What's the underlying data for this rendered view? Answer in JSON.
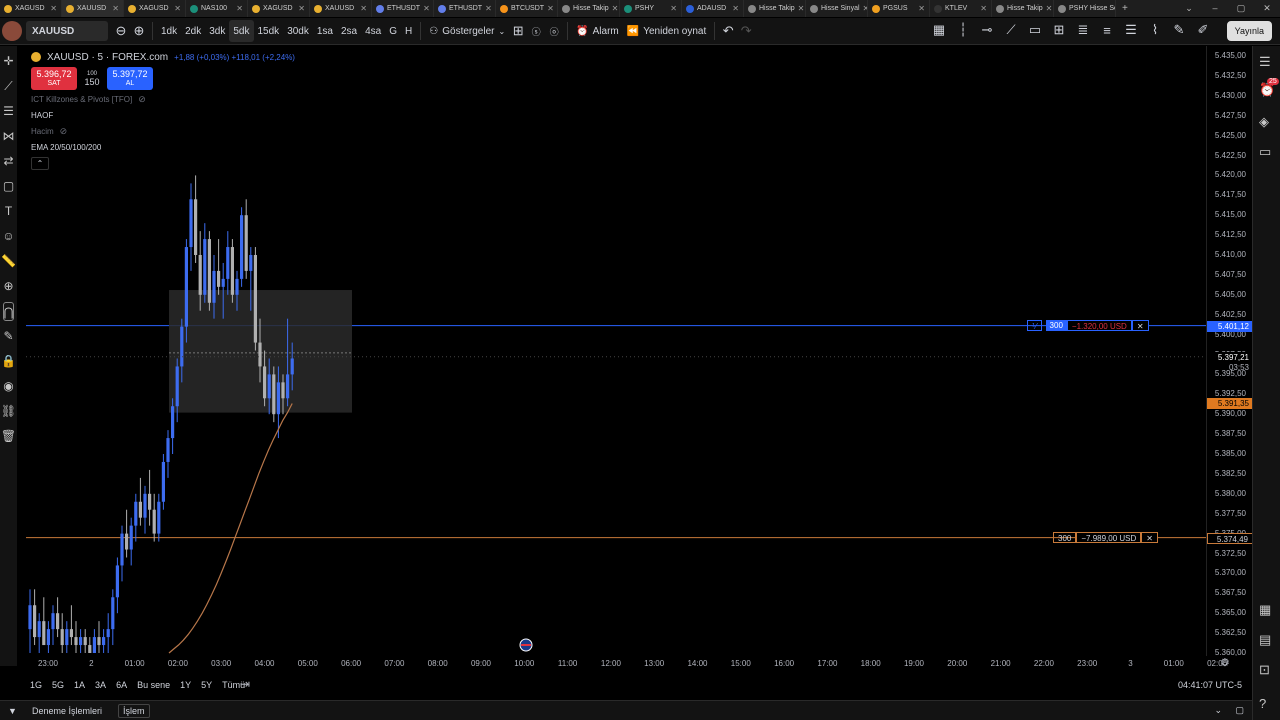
{
  "tabs": [
    {
      "label": "XAGUSD"
    },
    {
      "label": "XAUUSD"
    },
    {
      "label": "XAGUSD"
    },
    {
      "label": "NAS100"
    },
    {
      "label": "XAGUSD"
    },
    {
      "label": "XAUUSD"
    },
    {
      "label": "ETHUSDT"
    },
    {
      "label": "ETHUSDT"
    },
    {
      "label": "BTCUSDT"
    },
    {
      "label": "Hisse Takip"
    },
    {
      "label": "PSHY"
    },
    {
      "label": "ADAUSD"
    },
    {
      "label": "Hisse Takip"
    },
    {
      "label": "Hisse Sinyal"
    },
    {
      "label": "PGSUS"
    },
    {
      "label": "KTLEV"
    },
    {
      "label": "Hisse Takip"
    },
    {
      "label": "PSHY Hisse Senedi"
    }
  ],
  "toolbar": {
    "symbol": "XAUUSD",
    "timeframes": [
      "1dk",
      "2dk",
      "3dk",
      "5dk",
      "15dk",
      "30dk",
      "1sa",
      "2sa",
      "4sa",
      "G",
      "H"
    ],
    "active_timeframe": "5dk",
    "indicators_label": "Göstergeler",
    "alert_label": "Alarm",
    "replay_label": "Yeniden oynat",
    "publish_label": "Yayınla"
  },
  "legend": {
    "title": "XAUUSD · 5 · FOREX.com",
    "change": "+1,88 (+0,03%) +118,01 (+2,24%)",
    "sell_price": "5.396,72",
    "sell_label": "SAT",
    "spread_top": "100",
    "spread_qty": "150",
    "buy_price": "5.397,72",
    "buy_label": "AL",
    "indicator1": "ICT Killzones & Pivots [TFO]",
    "indicator2": "HAOF",
    "indicator3": "Hacim",
    "indicator4": "EMA 20/50/100/200"
  },
  "orders": [
    {
      "qty": "300",
      "pnl": "−1.320,00 USD",
      "price": "5.401,12"
    },
    {
      "qty": "300",
      "pnl": "−7.989,00 USD",
      "price": "5.374,49"
    }
  ],
  "price_axis": {
    "ticks": [
      "5.435,00",
      "5.432,50",
      "5.430,00",
      "5.427,50",
      "5.425,00",
      "5.422,50",
      "5.420,00",
      "5.417,50",
      "5.415,00",
      "5.412,50",
      "5.410,00",
      "5.407,50",
      "5.405,00",
      "5.402,50",
      "5.400,00",
      "5.397,50",
      "5.395,00",
      "5.392,50",
      "5.390,00",
      "5.387,50",
      "5.385,00",
      "5.382,50",
      "5.380,00",
      "5.377,50",
      "5.375,00",
      "5.372,50",
      "5.370,00",
      "5.367,50",
      "5.365,00",
      "5.362,50",
      "5.360,00"
    ],
    "current_price": "5.397,21",
    "countdown": "03:53",
    "ema_price": "5.391,35"
  },
  "time_axis": {
    "ticks": [
      "23:00",
      "2",
      "01:00",
      "02:00",
      "03:00",
      "04:00",
      "05:00",
      "06:00",
      "07:00",
      "08:00",
      "09:00",
      "10:00",
      "11:00",
      "12:00",
      "13:00",
      "14:00",
      "15:00",
      "16:00",
      "17:00",
      "18:00",
      "19:00",
      "20:00",
      "21:00",
      "22:00",
      "23:00",
      "3",
      "01:00",
      "02:00"
    ]
  },
  "range_buttons": [
    "1G",
    "5G",
    "1A",
    "3A",
    "6A",
    "Bu sene",
    "1Y",
    "5Y",
    "Tümü"
  ],
  "clock": "04:41:07 UTC-5",
  "bottom": {
    "tab1": "Deneme İşlemleri",
    "tab2": "İşlem"
  },
  "colors": {
    "up": "#3d6cf0",
    "down": "#b0b0b0",
    "ema": "#b8774a",
    "buy": "#2962ff",
    "sell": "#e0313f",
    "order_line2": "#c87a3a"
  },
  "chart_data": {
    "type": "candlestick",
    "price_range": [
      5360.0,
      5435.0
    ],
    "candles": [
      {
        "o": 5363,
        "h": 5368,
        "l": 5360,
        "c": 5366
      },
      {
        "o": 5366,
        "h": 5368,
        "l": 5361,
        "c": 5362
      },
      {
        "o": 5362,
        "h": 5365,
        "l": 5360,
        "c": 5364
      },
      {
        "o": 5364,
        "h": 5367,
        "l": 5361,
        "c": 5361
      },
      {
        "o": 5361,
        "h": 5364,
        "l": 5360,
        "c": 5363
      },
      {
        "o": 5363,
        "h": 5366,
        "l": 5361,
        "c": 5365
      },
      {
        "o": 5365,
        "h": 5367,
        "l": 5362,
        "c": 5363
      },
      {
        "o": 5363,
        "h": 5365,
        "l": 5360,
        "c": 5361
      },
      {
        "o": 5361,
        "h": 5364,
        "l": 5360,
        "c": 5363
      },
      {
        "o": 5363,
        "h": 5366,
        "l": 5361,
        "c": 5362
      },
      {
        "o": 5362,
        "h": 5364,
        "l": 5360,
        "c": 5361
      },
      {
        "o": 5361,
        "h": 5363,
        "l": 5360,
        "c": 5362
      },
      {
        "o": 5362,
        "h": 5363,
        "l": 5360,
        "c": 5361
      },
      {
        "o": 5361,
        "h": 5362,
        "l": 5360,
        "c": 5360
      },
      {
        "o": 5360,
        "h": 5363,
        "l": 5360,
        "c": 5362
      },
      {
        "o": 5362,
        "h": 5364,
        "l": 5360,
        "c": 5361
      },
      {
        "o": 5361,
        "h": 5363,
        "l": 5360,
        "c": 5362
      },
      {
        "o": 5362,
        "h": 5365,
        "l": 5360,
        "c": 5363
      },
      {
        "o": 5363,
        "h": 5368,
        "l": 5361,
        "c": 5367
      },
      {
        "o": 5367,
        "h": 5372,
        "l": 5365,
        "c": 5371
      },
      {
        "o": 5371,
        "h": 5376,
        "l": 5369,
        "c": 5375
      },
      {
        "o": 5375,
        "h": 5378,
        "l": 5372,
        "c": 5373
      },
      {
        "o": 5373,
        "h": 5377,
        "l": 5371,
        "c": 5376
      },
      {
        "o": 5376,
        "h": 5380,
        "l": 5374,
        "c": 5379
      },
      {
        "o": 5379,
        "h": 5382,
        "l": 5376,
        "c": 5377
      },
      {
        "o": 5377,
        "h": 5381,
        "l": 5375,
        "c": 5380
      },
      {
        "o": 5380,
        "h": 5383,
        "l": 5376,
        "c": 5378
      },
      {
        "o": 5378,
        "h": 5380,
        "l": 5374,
        "c": 5375
      },
      {
        "o": 5375,
        "h": 5380,
        "l": 5374,
        "c": 5379
      },
      {
        "o": 5379,
        "h": 5385,
        "l": 5378,
        "c": 5384
      },
      {
        "o": 5384,
        "h": 5388,
        "l": 5382,
        "c": 5387
      },
      {
        "o": 5387,
        "h": 5392,
        "l": 5385,
        "c": 5391
      },
      {
        "o": 5391,
        "h": 5397,
        "l": 5389,
        "c": 5396
      },
      {
        "o": 5396,
        "h": 5402,
        "l": 5394,
        "c": 5401
      },
      {
        "o": 5401,
        "h": 5412,
        "l": 5399,
        "c": 5411
      },
      {
        "o": 5411,
        "h": 5419,
        "l": 5408,
        "c": 5417
      },
      {
        "o": 5417,
        "h": 5420,
        "l": 5409,
        "c": 5410
      },
      {
        "o": 5410,
        "h": 5413,
        "l": 5403,
        "c": 5405
      },
      {
        "o": 5405,
        "h": 5414,
        "l": 5404,
        "c": 5412
      },
      {
        "o": 5412,
        "h": 5413,
        "l": 5403,
        "c": 5404
      },
      {
        "o": 5404,
        "h": 5410,
        "l": 5402,
        "c": 5408
      },
      {
        "o": 5408,
        "h": 5412,
        "l": 5405,
        "c": 5406
      },
      {
        "o": 5406,
        "h": 5409,
        "l": 5402,
        "c": 5407
      },
      {
        "o": 5407,
        "h": 5413,
        "l": 5405,
        "c": 5411
      },
      {
        "o": 5411,
        "h": 5412,
        "l": 5404,
        "c": 5405
      },
      {
        "o": 5405,
        "h": 5408,
        "l": 5403,
        "c": 5407
      },
      {
        "o": 5407,
        "h": 5416,
        "l": 5406,
        "c": 5415
      },
      {
        "o": 5415,
        "h": 5417,
        "l": 5407,
        "c": 5408
      },
      {
        "o": 5408,
        "h": 5411,
        "l": 5403,
        "c": 5410
      },
      {
        "o": 5410,
        "h": 5411,
        "l": 5398,
        "c": 5399
      },
      {
        "o": 5399,
        "h": 5402,
        "l": 5394,
        "c": 5396
      },
      {
        "o": 5396,
        "h": 5398,
        "l": 5391,
        "c": 5392
      },
      {
        "o": 5392,
        "h": 5397,
        "l": 5390,
        "c": 5395
      },
      {
        "o": 5395,
        "h": 5396,
        "l": 5389,
        "c": 5390
      },
      {
        "o": 5390,
        "h": 5396,
        "l": 5387,
        "c": 5394
      },
      {
        "o": 5394,
        "h": 5395,
        "l": 5390,
        "c": 5392
      },
      {
        "o": 5392,
        "h": 5402,
        "l": 5391,
        "c": 5395
      },
      {
        "o": 5395,
        "h": 5399,
        "l": 5393,
        "c": 5397
      }
    ],
    "ema": [
      5360,
      5360.5,
      5361,
      5361.6,
      5362.3,
      5363.1,
      5364,
      5365,
      5366.1,
      5367.3,
      5368.6,
      5370,
      5371.5,
      5373,
      5374.6,
      5376.2,
      5377.8,
      5379.4,
      5381,
      5382.6,
      5384.1,
      5385.5,
      5386.8,
      5388,
      5389.2,
      5390.2,
      5391.35
    ]
  }
}
